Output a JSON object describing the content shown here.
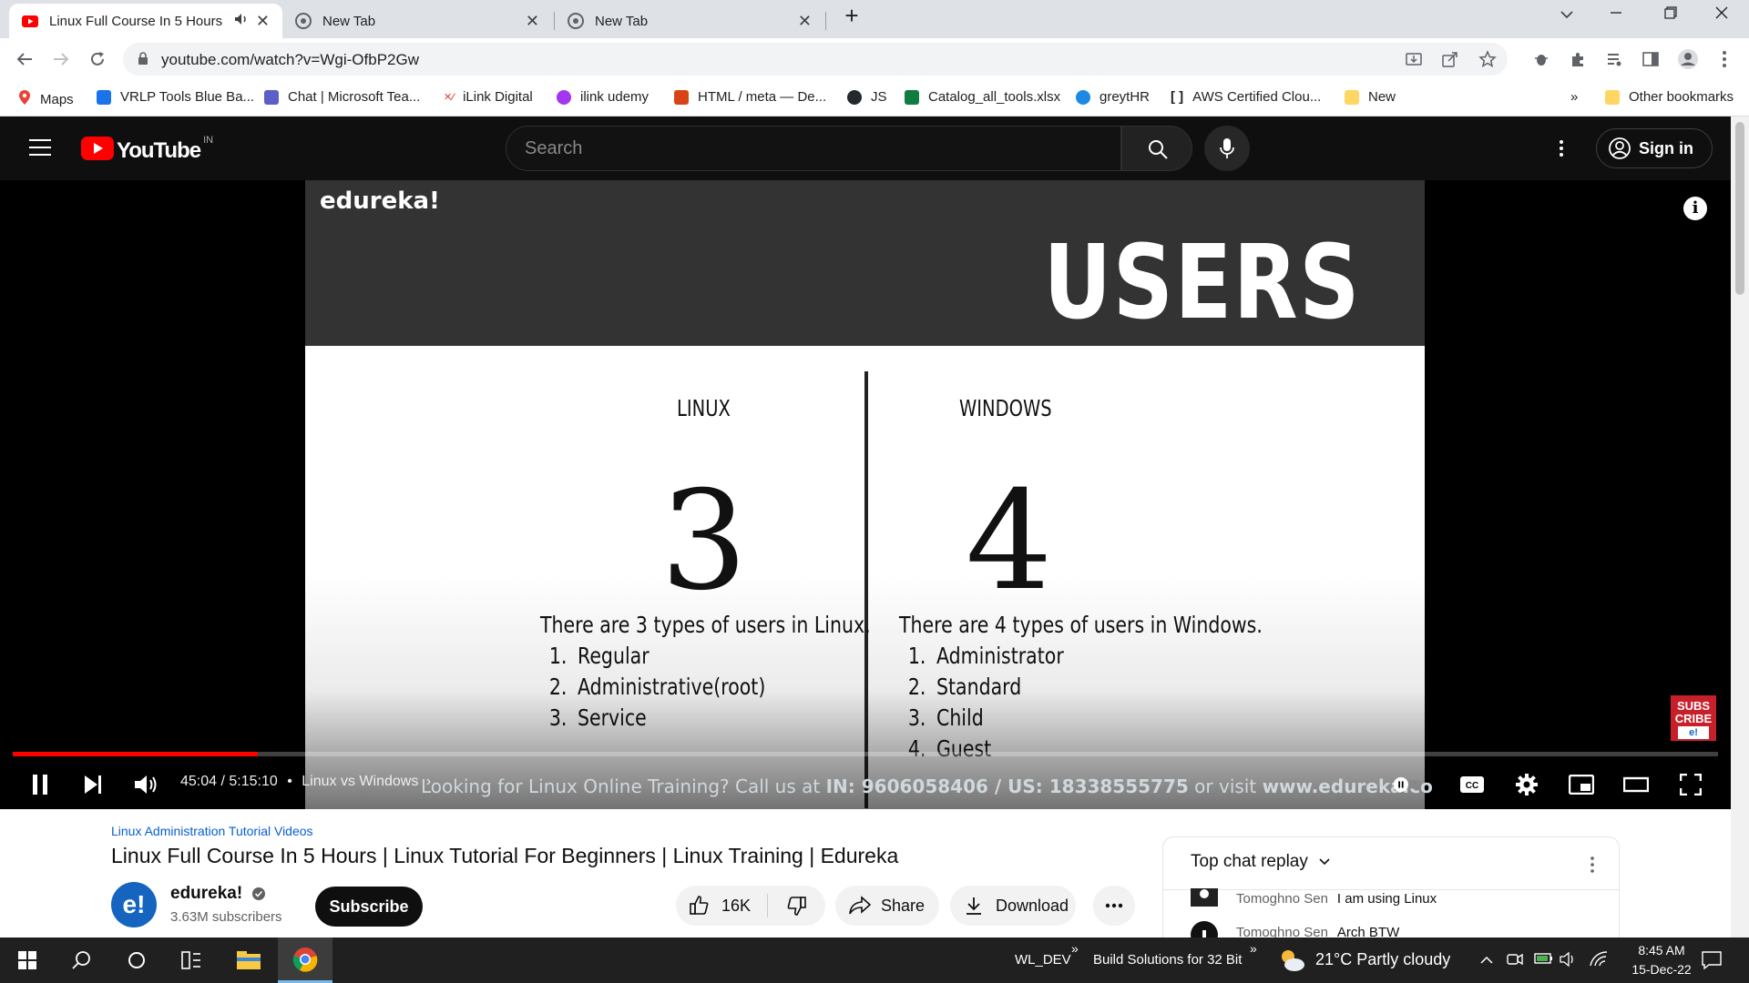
{
  "browser": {
    "tabs": [
      {
        "title": "Linux Full Course In 5 Hours",
        "active": true,
        "audio": true
      },
      {
        "title": "New Tab",
        "active": false
      },
      {
        "title": "New Tab",
        "active": false
      }
    ],
    "new_tab_symbol": "+",
    "url": "youtube.com/watch?v=Wgi-OfbP2Gw",
    "bookmarks": [
      {
        "label": "Maps",
        "icon": "maps-pin-icon",
        "color": "#ea4335"
      },
      {
        "label": "VRLP Tools Blue Ba...",
        "icon": "vrlp-icon",
        "color": "#1a73e8"
      },
      {
        "label": "Chat | Microsoft Tea...",
        "icon": "teams-icon",
        "color": "#5b5fc7"
      },
      {
        "label": "iLink Digital",
        "icon": "ilink-icon",
        "color": "#e53935"
      },
      {
        "label": "ilink udemy",
        "icon": "udemy-icon",
        "color": "#a435f0"
      },
      {
        "label": "HTML / meta — De...",
        "icon": "mdn-icon",
        "color": "#d84315"
      },
      {
        "label": "JS",
        "icon": "github-icon",
        "color": "#24292f"
      },
      {
        "label": "Catalog_all_tools.xlsx",
        "icon": "excel-icon",
        "color": "#107c41"
      },
      {
        "label": "greytHR",
        "icon": "greythr-icon",
        "color": "#1e88e5"
      },
      {
        "label": "AWS Certified Clou...",
        "icon": "aws-bracket-icon",
        "color": "#202124"
      },
      {
        "label": "New",
        "icon": "folder-icon",
        "color": "#fdd663"
      }
    ],
    "overflow_chevron": "»",
    "other_bookmarks": "Other bookmarks"
  },
  "youtube": {
    "logo_text": "YouTube",
    "country": "IN",
    "search_placeholder": "Search",
    "sign_in": "Sign in"
  },
  "video": {
    "slide": {
      "brand": "edureka!",
      "heading": "USERS",
      "linux": {
        "title": "LINUX",
        "count": "3",
        "intro": "There are 3 types of users in Linux.",
        "items": [
          {
            "n": "1.",
            "text": "Regular"
          },
          {
            "n": "2.",
            "text": "Administrative(root)"
          },
          {
            "n": "3.",
            "text": "Service"
          }
        ]
      },
      "windows": {
        "title": "WINDOWS",
        "count": "4",
        "intro": "There are 4 types of users in Windows.",
        "items": [
          {
            "n": "1.",
            "text": "Administrator"
          },
          {
            "n": "2.",
            "text": "Standard"
          },
          {
            "n": "3.",
            "text": "Child"
          },
          {
            "n": "4.",
            "text": "Guest"
          }
        ]
      }
    },
    "subscribe_badge": [
      "SUBS",
      "CRIBE",
      "e!"
    ],
    "current_time": "45:04",
    "duration": "5:15:10",
    "time_display": "45:04 / 5:15:10",
    "chapter": "Linux vs Windows",
    "played_fraction": 0.1437,
    "buffered_fraction": 0.131,
    "ticker_prefix": "Looking for Linux Online Training? Call us at ",
    "ticker_phone": "IN: 9606058406 / US: 18338555775",
    "ticker_mid": " or visit ",
    "ticker_site": "www.edureka.co",
    "accent_red": "#ff0000"
  },
  "details": {
    "playlist": "Linux Administration Tutorial Videos",
    "title": "Linux Full Course In 5 Hours | Linux Tutorial For Beginners | Linux Training | Edureka",
    "channel_initial": "e!",
    "channel": "edureka!",
    "subscribers": "3.63M subscribers",
    "subscribe": "Subscribe",
    "likes": "16K",
    "share": "Share",
    "download": "Download"
  },
  "chat": {
    "title": "Top chat replay",
    "messages": [
      {
        "author": "Tomoghno Sen",
        "text": "I am using Linux"
      },
      {
        "author": "Tomoghno Sen",
        "text": "Arch BTW"
      }
    ]
  },
  "taskbar": {
    "notif_1": "WL_DEV",
    "notif_2": "Build Solutions for 32 Bit",
    "weather": "21°C  Partly cloudy",
    "time": "8:45 AM",
    "date": "15-Dec-22"
  }
}
